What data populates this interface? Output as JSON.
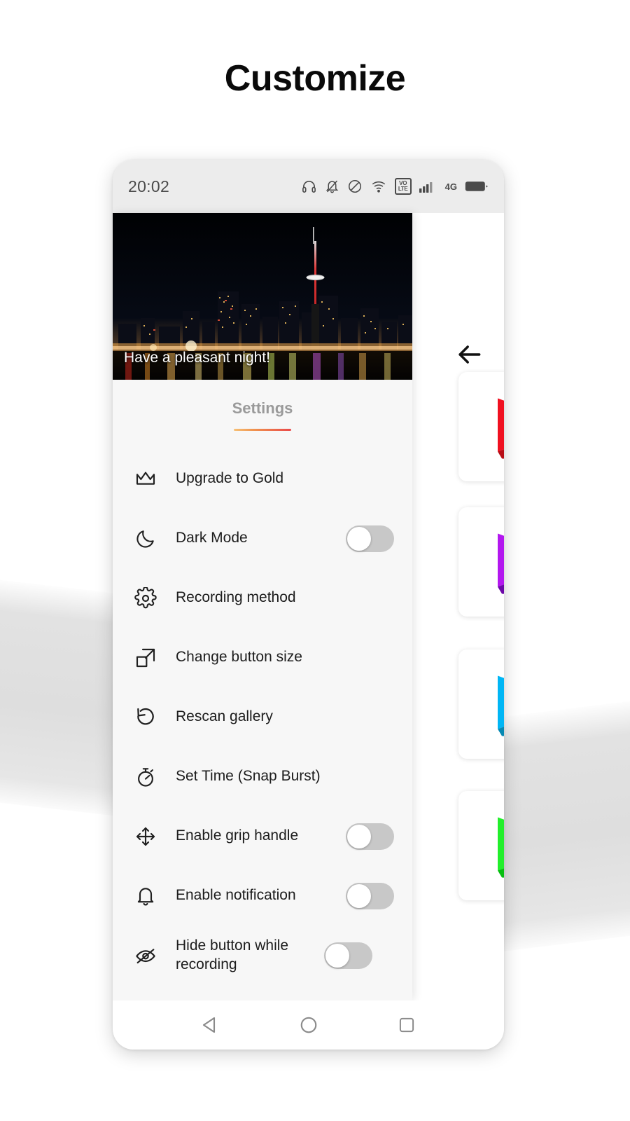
{
  "page": {
    "title": "Customize"
  },
  "phone": {
    "statusbar": {
      "time": "20:02",
      "icons": [
        "headset-icon",
        "bell-off-icon",
        "do-not-disturb-icon",
        "wifi-icon",
        "volte-icon",
        "signal-icon",
        "network-4g-icon",
        "battery-icon"
      ],
      "volte_top": "VO",
      "volte_bottom": "LTE",
      "network_label": "4G"
    },
    "background_screen": {
      "back_label": "back-arrow",
      "cards": [
        {
          "name": "card-red",
          "color": "#e8172a"
        },
        {
          "name": "card-purple",
          "color": "#a817e8"
        },
        {
          "name": "card-cyan",
          "color": "#00b6ef"
        },
        {
          "name": "card-green",
          "color": "#1ae81a"
        }
      ]
    },
    "drawer": {
      "hero_caption": "Have a pleasant night!",
      "title": "Settings",
      "items": [
        {
          "icon": "crown-icon",
          "label": "Upgrade to Gold",
          "toggle": null
        },
        {
          "icon": "moon-icon",
          "label": "Dark Mode",
          "toggle": "off"
        },
        {
          "icon": "gear-icon",
          "label": "Recording method",
          "toggle": null
        },
        {
          "icon": "resize-icon",
          "label": "Change button size",
          "toggle": null
        },
        {
          "icon": "refresh-icon",
          "label": "Rescan gallery",
          "toggle": null
        },
        {
          "icon": "stopwatch-icon",
          "label": "Set Time (Snap Burst)",
          "toggle": null
        },
        {
          "icon": "move-arrows-icon",
          "label": "Enable grip handle",
          "toggle": "off"
        },
        {
          "icon": "bell-icon",
          "label": "Enable notification",
          "toggle": "off"
        },
        {
          "icon": "eye-off-icon",
          "label": "Hide button while recording",
          "toggle": "off"
        }
      ]
    },
    "navbar": {
      "back": "nav-back-icon",
      "home": "nav-home-icon",
      "recents": "nav-recents-icon"
    }
  },
  "colors": {
    "accent_start": "#f6c177",
    "accent_end": "#ea4a4a",
    "drawer_bg": "#f7f7f7",
    "toggle_track": "#c8c8c8"
  }
}
